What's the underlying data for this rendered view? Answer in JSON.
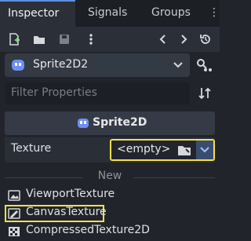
{
  "tabs": [
    {
      "label": "Inspector"
    },
    {
      "label": "Signals"
    },
    {
      "label": "Groups"
    }
  ],
  "node": {
    "name": "Sprite2D2",
    "type": "Sprite2D"
  },
  "filter": {
    "placeholder": "Filter Properties"
  },
  "property": {
    "name": "Texture",
    "value": "<empty>"
  },
  "menu": {
    "section": "New",
    "items": [
      {
        "label": "ViewportTexture",
        "icon": "viewport-texture-icon"
      },
      {
        "label": "CanvasTexture",
        "icon": "canvas-texture-icon"
      },
      {
        "label": "CompressedTexture2D",
        "icon": "compressed-texture-icon"
      }
    ]
  },
  "colors": {
    "accent": "#5e8fd9",
    "highlight": "#f2e04a",
    "node_icon": "#6f8ff5"
  }
}
